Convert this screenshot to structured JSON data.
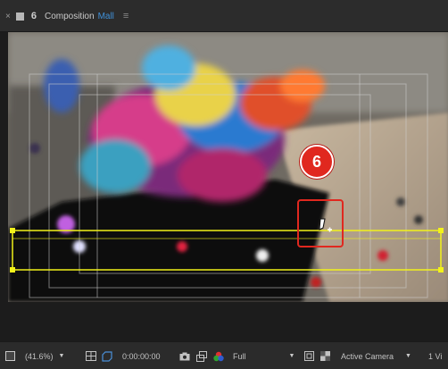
{
  "tab": {
    "close_glyph": "×",
    "lock_glyph": "6",
    "prefix": "Composition",
    "name": "Mall",
    "menu_glyph": "≡",
    "name_color": "#3f8fd6"
  },
  "callout": {
    "step_number": "6",
    "color": "#e0281f"
  },
  "mask": {
    "color": "#f2f21a"
  },
  "statusbar": {
    "zoom_value": "(41.6%)",
    "timecode": "0:00:00:00",
    "resolution": "Full",
    "camera": "Active Camera",
    "views": "1 Vi"
  }
}
